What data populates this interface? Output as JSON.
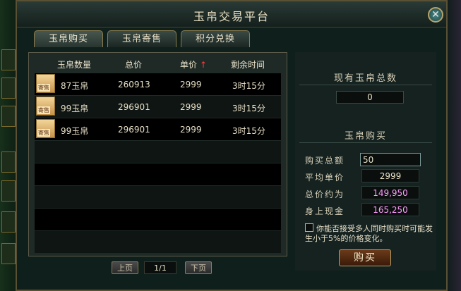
{
  "window": {
    "title": "玉帛交易平台"
  },
  "tabs": [
    {
      "label": "玉帛购买",
      "active": true
    },
    {
      "label": "玉帛寄售",
      "active": false
    },
    {
      "label": "积分兑换",
      "active": false
    }
  ],
  "table": {
    "headers": [
      "玉帛数量",
      "总价",
      "单价",
      "剩余时间"
    ],
    "sort_arrow": "↑",
    "rows": [
      {
        "icon_tag": "寄售",
        "qty": "87玉帛",
        "total": "260913",
        "unit": "2999",
        "time": "3时15分"
      },
      {
        "icon_tag": "寄售",
        "qty": "99玉帛",
        "total": "296901",
        "unit": "2999",
        "time": "3时15分"
      },
      {
        "icon_tag": "寄售",
        "qty": "99玉帛",
        "total": "296901",
        "unit": "2999",
        "time": "3时15分"
      }
    ],
    "empty_rows": 5
  },
  "pager": {
    "prev": "上页",
    "page": "1/1",
    "next": "下页"
  },
  "holdings": {
    "title": "现有玉帛总数",
    "value": "0"
  },
  "buy": {
    "title": "玉帛购买",
    "qty_label": "购买总额",
    "qty_value": "50",
    "avg_label": "平均单价",
    "avg_value": "2999",
    "total_label": "总价约为",
    "total_value": "149,950",
    "cash_label": "身上现金",
    "cash_value": "165,250",
    "agree_text": "你能否接受多人同时购买时可能发生小于5%的价格变化。",
    "button": "购买"
  },
  "colors": {
    "accent_pink": "#ff9cff",
    "sort_arrow": "#ff3a3a",
    "border_gold": "#b7a36b"
  }
}
